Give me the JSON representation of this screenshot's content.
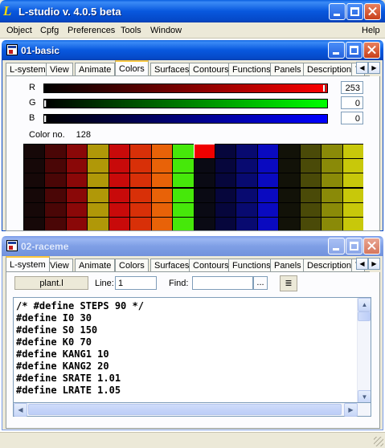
{
  "app": {
    "title": "L-studio v. 4.0.5 beta",
    "logo_letter": "L"
  },
  "menubar": {
    "items": [
      "Object",
      "Cpfg",
      "Preferences",
      "Tools",
      "Window"
    ],
    "help": "Help"
  },
  "window1": {
    "title": "01-basic",
    "tabs": [
      "L-system",
      "View",
      "Animate",
      "Colors",
      "Surfaces",
      "Contours",
      "Functions",
      "Panels",
      "Description",
      "T"
    ],
    "selected_tab": "Colors",
    "colors": {
      "r_label": "R",
      "r_value": "253",
      "r_fraction": 0.992,
      "g_label": "G",
      "g_value": "0",
      "g_fraction": 0.0,
      "b_label": "B",
      "b_value": "0",
      "b_fraction": 0.0,
      "color_no_label": "Color no.",
      "color_no_value": "128"
    },
    "palette_columns": [
      "#160808",
      "#4a0606",
      "#8a0808",
      "#b09808",
      "#c80a0a",
      "#d83008",
      "#e86208",
      "#46e80a",
      "#0a0a14",
      "#06063c",
      "#080a70",
      "#0a0ac0",
      "#121208",
      "#4a4a08",
      "#8a8a08",
      "#c8c80a"
    ],
    "palette_rows": 6,
    "selected_cell": {
      "column": 8,
      "row": 0,
      "color": "#f00000"
    }
  },
  "window2": {
    "title": "02-raceme",
    "tabs": [
      "L-system",
      "View",
      "Animate",
      "Colors",
      "Surfaces",
      "Contours",
      "Functions",
      "Panels",
      "Description",
      "T"
    ],
    "selected_tab": "L-system",
    "file_button": "plant.l",
    "line_label": "Line:",
    "line_value": "1",
    "find_label": "Find:",
    "find_value": "",
    "browse_label": "...",
    "code_lines": [
      "/* #define STEPS 90 */",
      "#define I0 30",
      "#define S0 150",
      "#define K0 70",
      "#define KANG1 10",
      "#define KANG2 20",
      "#define SRATE 1.01",
      "#define LRATE 1.05"
    ]
  },
  "icons": {
    "minimize": "minimize-icon",
    "maximize": "maximize-icon",
    "close": "close-icon",
    "tab_left": "◀",
    "tab_right": "▶",
    "scroll_up": "▲",
    "scroll_down": "▼",
    "scroll_left": "◀",
    "scroll_right": "▶",
    "search_glyph": "≣"
  }
}
